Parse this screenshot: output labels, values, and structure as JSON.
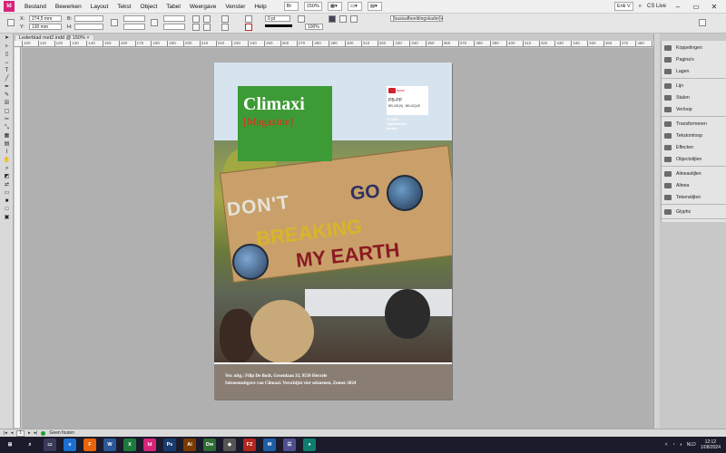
{
  "menubar": {
    "logo": "Id",
    "items": [
      "Bestand",
      "Bewerken",
      "Layout",
      "Tekst",
      "Object",
      "Tabel",
      "Weergave",
      "Venster",
      "Help"
    ],
    "zoom": "150%",
    "user": "Erik V",
    "cslive": "CS Live"
  },
  "controlbar": {
    "x_label": "X:",
    "x_value": "274,5 mm",
    "y_label": "Y:",
    "y_value": "130 mm",
    "b_label": "B:",
    "h_label": "H:",
    "stroke_value": "0 pt",
    "opacity_value": "100%",
    "frame_style": "[basisafbeeldingskader]+"
  },
  "document": {
    "tab_label": "Lederblad met2.indd @ 150%"
  },
  "ruler": {
    "ticks": [
      "100",
      "110",
      "120",
      "130",
      "140",
      "150",
      "160",
      "170",
      "180",
      "190",
      "200",
      "210",
      "220",
      "230",
      "240",
      "250",
      "260",
      "270",
      "280",
      "290",
      "300",
      "310",
      "320",
      "330",
      "340",
      "350",
      "360",
      "370",
      "380",
      "390",
      "400",
      "410",
      "420",
      "430",
      "440",
      "450",
      "460",
      "470",
      "480",
      "490"
    ]
  },
  "cover": {
    "title": "Climaxi",
    "subtitle": "[Magazine]",
    "postal_brand": "bpost",
    "postal_code": "PB-PP",
    "postal_country": "BELGIE(N) - BELGIQUE",
    "postal_lines": [
      "P710631",
      "Afgiftekantoor",
      "Herzele"
    ],
    "sign_words": [
      "DON'T",
      "GO",
      "BREAKING",
      "MY EARTH"
    ],
    "footer_line1": "Ver. uitg.: Filip De Bodt, Groenlaan 33, 9550 Herzele",
    "footer_line2": "Seizoensuitgave van Climaxi. Verschijnt vier seizoenen, Zomer 2024"
  },
  "panels": {
    "group1": [
      "Koppelingen",
      "Pagina's",
      "Lagen"
    ],
    "group2": [
      "Lijn",
      "Stalen",
      "Verloop"
    ],
    "group3": [
      "Transformeren",
      "Tekstomloop",
      "Effecten",
      "Objectstijlen"
    ],
    "group4": [
      "Alineastijlen",
      "Alinea",
      "Tekenstijlen"
    ],
    "group5": [
      "Glyphs"
    ]
  },
  "statusbar": {
    "page": "1",
    "preflight": "Geen fouten"
  },
  "taskbar": {
    "lang": "NLD",
    "time": "12:12",
    "date": "1/08/2024",
    "apps": [
      {
        "label": "⊞",
        "color": "#1b1b2b"
      },
      {
        "label": "⌕",
        "color": "#1b1b2b"
      },
      {
        "label": "▭",
        "color": "#3a3a5a"
      },
      {
        "label": "e",
        "color": "#1a6fd1"
      },
      {
        "label": "F",
        "color": "#e8630a"
      },
      {
        "label": "W",
        "color": "#2b5797"
      },
      {
        "label": "X",
        "color": "#1d7a3c"
      },
      {
        "label": "Id",
        "color": "#d6247b"
      },
      {
        "label": "Ps",
        "color": "#1a3b6e"
      },
      {
        "label": "Ai",
        "color": "#7a3a00"
      },
      {
        "label": "Dw",
        "color": "#2f6b34"
      },
      {
        "label": "◆",
        "color": "#555"
      },
      {
        "label": "FZ",
        "color": "#b3261e"
      },
      {
        "label": "✉",
        "color": "#1f5fa8"
      },
      {
        "label": "☰",
        "color": "#4f4f8f"
      },
      {
        "label": "●",
        "color": "#0f7d6e"
      }
    ]
  }
}
